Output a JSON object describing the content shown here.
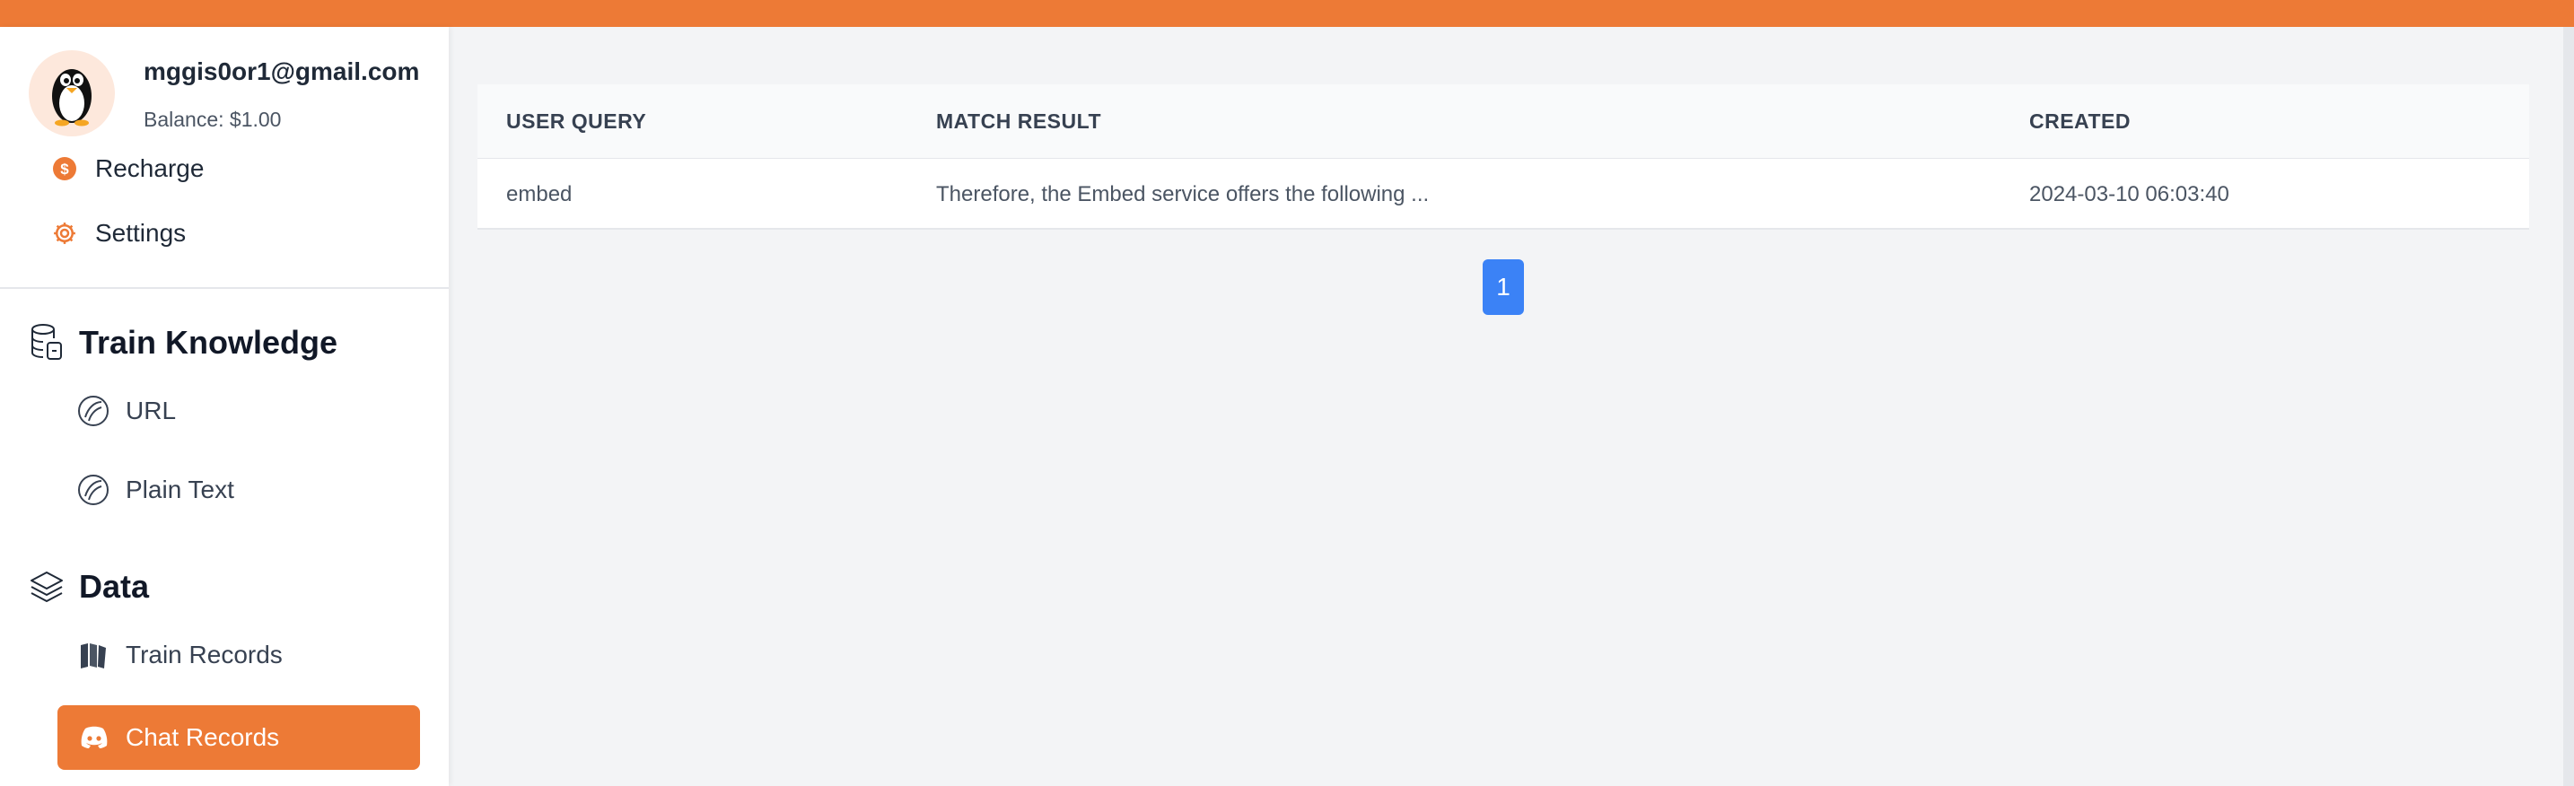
{
  "user": {
    "email": "mggis0or1@gmail.com",
    "balance": "Balance: $1.00"
  },
  "menu": {
    "recharge": "Recharge",
    "settings": "Settings"
  },
  "sections": {
    "train_knowledge": {
      "title": "Train Knowledge",
      "items": [
        "URL",
        "Plain Text"
      ]
    },
    "data": {
      "title": "Data",
      "items": [
        "Train Records",
        "Chat Records"
      ]
    }
  },
  "table": {
    "headers": [
      "USER QUERY",
      "MATCH RESULT",
      "CREATED"
    ],
    "rows": [
      [
        "embed",
        "Therefore, the Embed service offers the following ...",
        "2024-03-10 06:03:40"
      ]
    ]
  },
  "pagination": {
    "current": "1"
  },
  "colors": {
    "accent": "#ed7a36",
    "page_active": "#3b82f6",
    "background": "#f3f4f6"
  },
  "icons": {
    "avatar": "penguin-avatar",
    "recharge": "coin-icon",
    "settings": "gear-icon",
    "train_knowledge": "database-icon",
    "url": "globe-icon",
    "plain_text": "globe-icon",
    "data": "layers-icon",
    "train_records": "books-icon",
    "chat_records": "discord-icon"
  }
}
